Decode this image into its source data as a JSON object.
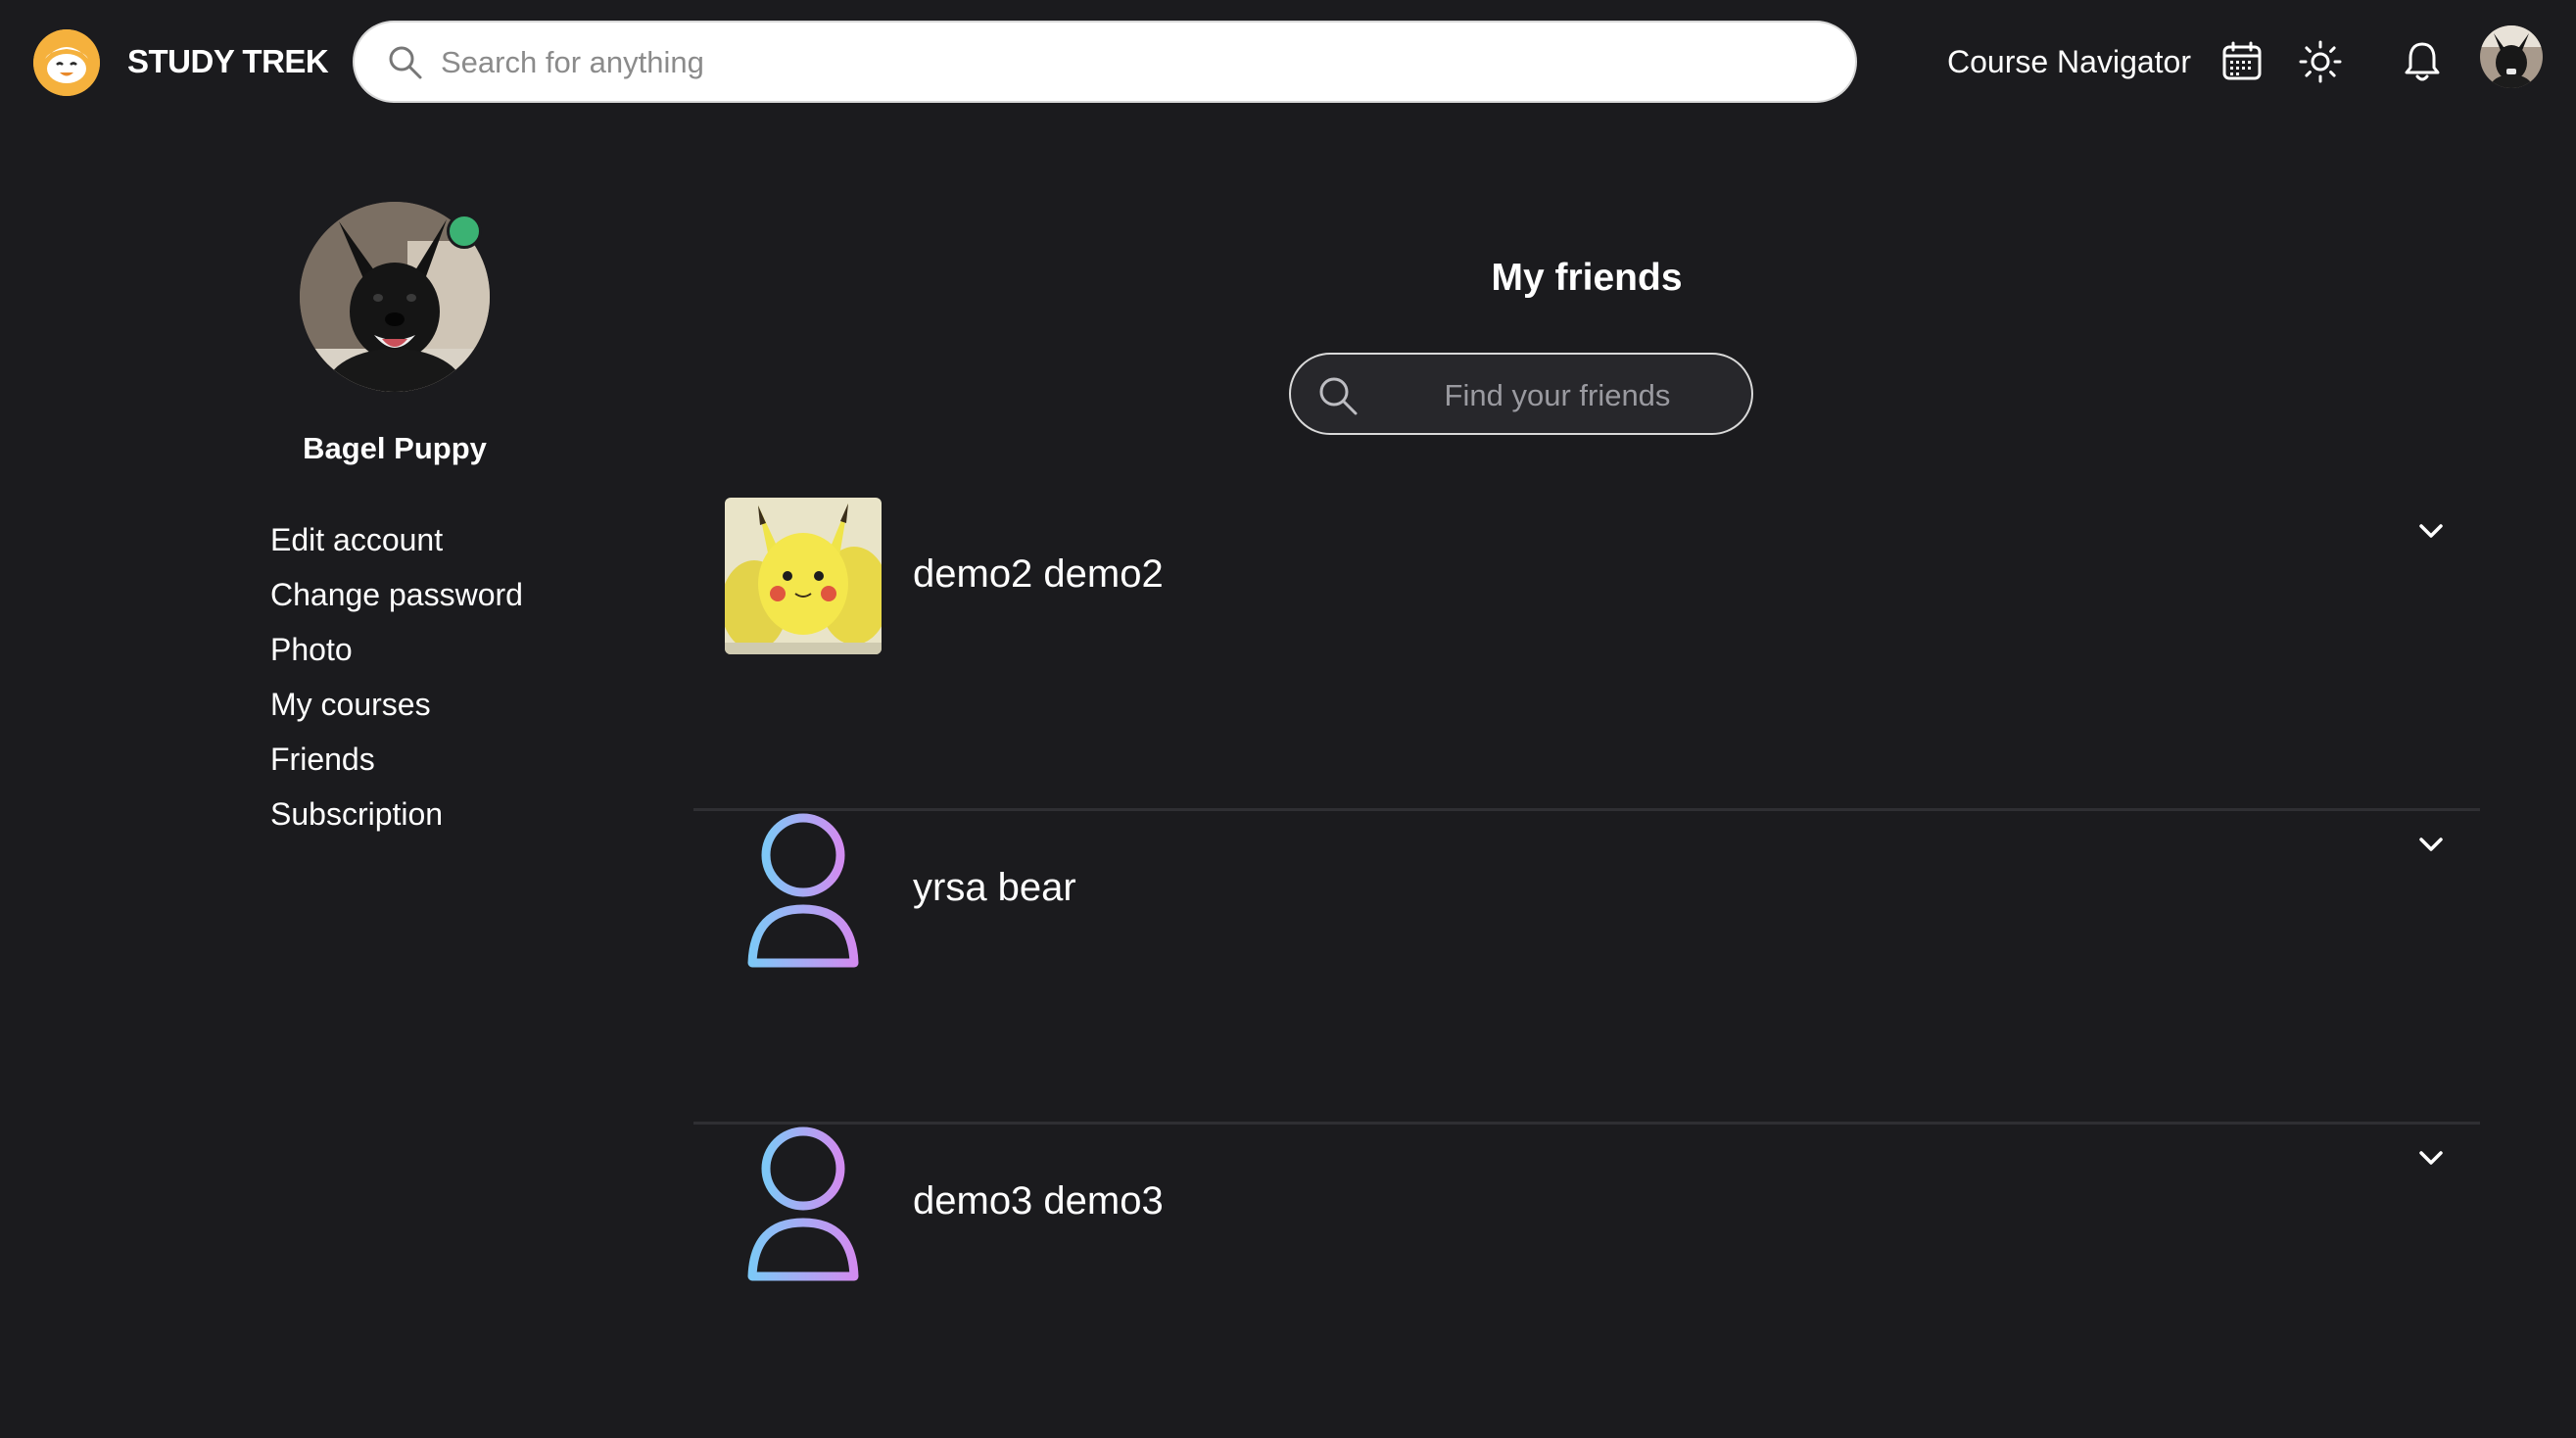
{
  "header": {
    "brand": "STUDY TREK",
    "search_placeholder": "Search for anything",
    "course_navigator": "Course Navigator",
    "icons": [
      "calendar-icon",
      "sun-icon",
      "bell-icon"
    ]
  },
  "profile": {
    "name": "Bagel Puppy",
    "status": "online",
    "menu": [
      "Edit account",
      "Change password",
      "Photo",
      "My courses",
      "Friends",
      "Subscription"
    ]
  },
  "friends_page": {
    "title": "My friends",
    "search_placeholder": "Find your friends",
    "friends": [
      {
        "name": "demo2 demo2",
        "avatar": "pikachu-photo"
      },
      {
        "name": "yrsa bear",
        "avatar": "default-user-icon"
      },
      {
        "name": "demo3 demo3",
        "avatar": "default-user-icon"
      }
    ]
  },
  "colors": {
    "background": "#1b1b1e",
    "brand_logo": "#f5b13d",
    "online": "#3bb273",
    "avatar_gradient_start": "#7ec8f7",
    "avatar_gradient_end": "#d18cf0"
  }
}
